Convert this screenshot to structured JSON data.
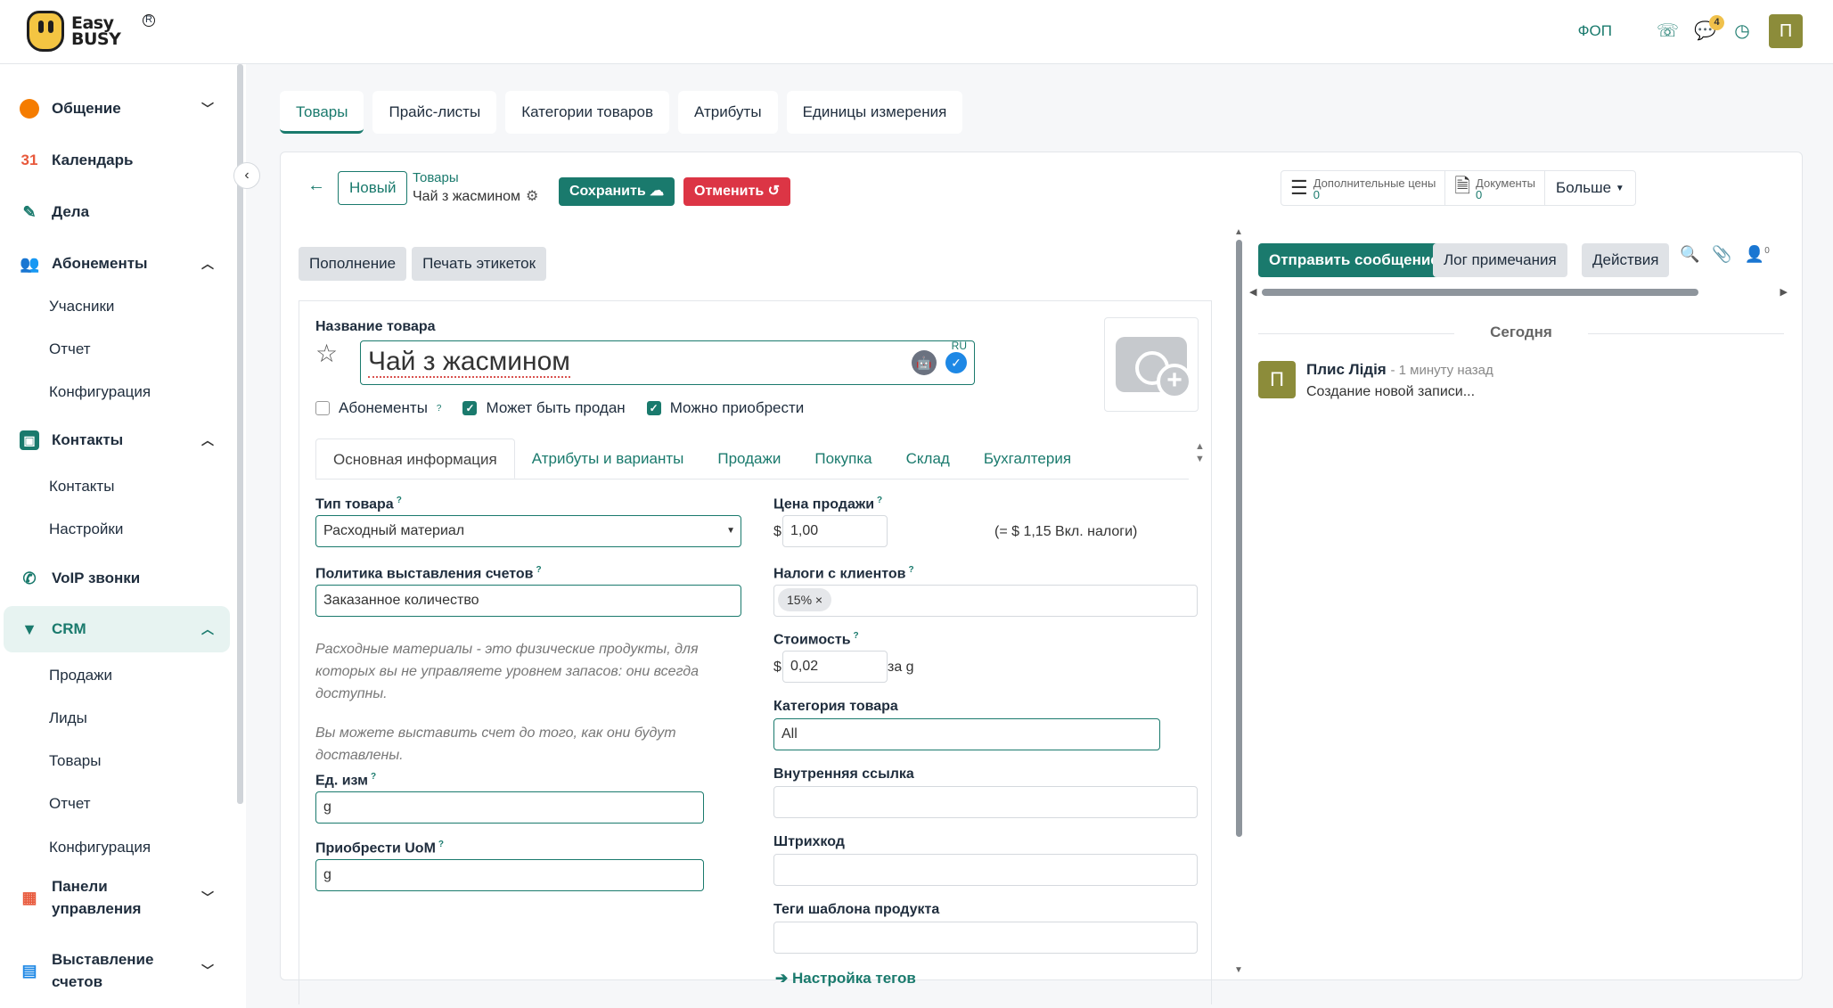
{
  "brand": {
    "line1": "Easy",
    "line2": "BUSY",
    "reg": "R"
  },
  "topbar": {
    "company": "ФОП",
    "messages_count": "4",
    "user_initial": "П"
  },
  "sidebar": {
    "items": [
      {
        "label": "Общение",
        "icon": "chat-bubble-icon"
      },
      {
        "label": "Календарь",
        "icon": "calendar-icon",
        "icon_text": "31"
      },
      {
        "label": "Дела",
        "icon": "pen-icon"
      },
      {
        "label": "Абонементы",
        "icon": "users-icon"
      },
      {
        "label": "Учасники"
      },
      {
        "label": "Отчет"
      },
      {
        "label": "Конфигурация"
      },
      {
        "label": "Контакты",
        "icon": "address-book-icon"
      },
      {
        "label": "Контакты"
      },
      {
        "label": "Настройки"
      },
      {
        "label": "VoIP звонки",
        "icon": "phone-icon"
      },
      {
        "label": "CRM",
        "icon": "crm-icon"
      },
      {
        "label": "Продажи"
      },
      {
        "label": "Лиды"
      },
      {
        "label": "Товары"
      },
      {
        "label": "Отчет"
      },
      {
        "label": "Конфигурация"
      },
      {
        "label_line1": "Панели",
        "label_line2": "управления",
        "icon": "dashboard-icon"
      },
      {
        "label_line1": "Выставление",
        "label_line2": "счетов",
        "icon": "invoice-icon"
      }
    ]
  },
  "top_tabs": [
    "Товары",
    "Прайс-листы",
    "Категории товаров",
    "Атрибуты",
    "Единицы измерения"
  ],
  "control_panel": {
    "new_button": "Новый",
    "breadcrumb": "Товары",
    "record_name": "Чай з жасмином",
    "save": "Сохранить",
    "cancel": "Отменить",
    "extra_prices_label": "Дополнительные цены",
    "extra_prices_value": "0",
    "documents_label": "Документы",
    "documents_value": "0",
    "more": "Больше"
  },
  "actions": {
    "replenish": "Пополнение",
    "print_labels": "Печать этикеток"
  },
  "product": {
    "name_label": "Название товара",
    "name": "Чай з жасмином",
    "lang": "RU",
    "checkboxes": [
      {
        "label": "Абонементы",
        "checked": false,
        "help": "?"
      },
      {
        "label": "Может быть продан",
        "checked": true
      },
      {
        "label": "Можно приобрести",
        "checked": true
      }
    ]
  },
  "notebook_tabs": [
    "Основная информация",
    "Атрибуты и варианты",
    "Продажи",
    "Покупка",
    "Склад",
    "Бухгалтерия"
  ],
  "general": {
    "type_label": "Тип товара",
    "type_value": "Расходный материал",
    "invoice_policy_label": "Политика выставления счетов",
    "invoice_policy_value": "Заказанное количество",
    "help1": "Расходные материалы - это физические продукты, для которых вы не управляете уровнем запасов: они всегда доступны.",
    "help2": "Вы можете выставить счет до того, как они будут доставлены.",
    "uom_label": "Ед. изм",
    "uom_value": "g",
    "purchase_uom_label": "Приобрести UoM",
    "purchase_uom_value": "g",
    "sale_price_label": "Цена продажи",
    "currency": "$",
    "sale_price": "1,00",
    "tax_included": "(= $ 1,15 Вкл. налоги)",
    "customer_taxes_label": "Налоги с клиентов",
    "tax_tag": "15%",
    "cost_label": "Стоимость",
    "cost": "0,02",
    "cost_per": "за g",
    "category_label": "Категория товара",
    "category": "All",
    "internal_ref_label": "Внутренняя ссылка",
    "barcode_label": "Штрихкод",
    "tags_label": "Теги шаблона продукта",
    "tags_link": "Настройка тегов"
  },
  "chatter": {
    "send": "Отправить сообщение",
    "log": "Лог примечания",
    "activities": "Действия",
    "followers": "0",
    "today": "Сегодня",
    "author": "Плис Лідія",
    "time": "- 1 минуту назад",
    "body": "Создание новой записи...",
    "author_initial": "П"
  },
  "colors": {
    "primary": "#1a7a6d",
    "danger": "#dc3545",
    "logo": "#f4c542"
  }
}
